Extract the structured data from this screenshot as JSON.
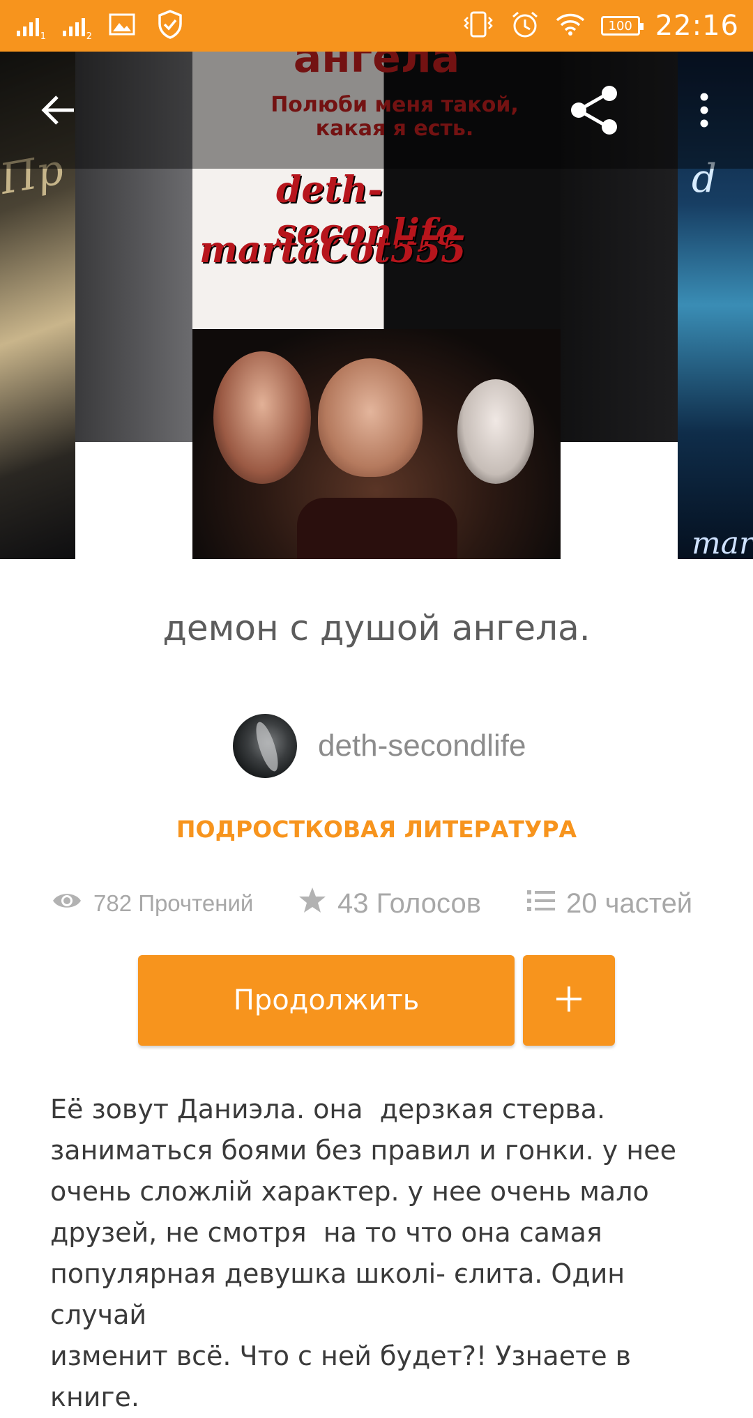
{
  "status_bar": {
    "time": "22:16",
    "battery": "100",
    "sim1_label": "1",
    "sim2_label": "2",
    "icons": [
      "signal-sim1-icon",
      "signal-sim2-icon",
      "image-icon",
      "shield-check-icon",
      "vibrate-icon",
      "alarm-icon",
      "wifi-icon",
      "battery-icon"
    ]
  },
  "cover": {
    "title_text": "ангела",
    "subtitle_text": "Полюби меня такой, какая я есть.",
    "author_line1": "deth-seconlife",
    "author_line2": "martaCot555",
    "left_cover_text": "Пр",
    "right_cover_text": "d",
    "right_cover_bottom_text": "mar"
  },
  "toolbar": {
    "back_icon": "arrow-left-icon",
    "share_icon": "share-icon",
    "more_icon": "more-vertical-icon"
  },
  "story": {
    "title": "демон с душой ангела.",
    "author": "deth-secondlife",
    "genre": "ПОДРОСТКОВАЯ ЛИТЕРАТУРА",
    "reads": "782 Прочтений",
    "votes": "43 Голосов",
    "parts": "20 частей",
    "description": "Её зовут Даниэла. она  дерзкая стерва.\nзаниматься боями без правил и гонки. у нее\nочень сложлій характер. у нее очень мало\nдрузей, не смотря  на то что она самая\nпопулярная девушка школі- єлита. Один случай\nизменит всё. Что с ней будет?! Узнаете в книге."
  },
  "actions": {
    "continue_label": "Продолжить",
    "add_icon": "plus-icon"
  },
  "colors": {
    "accent": "#f7941d",
    "title_text": "#5c5c5c",
    "meta_text": "#a8a8a8"
  }
}
